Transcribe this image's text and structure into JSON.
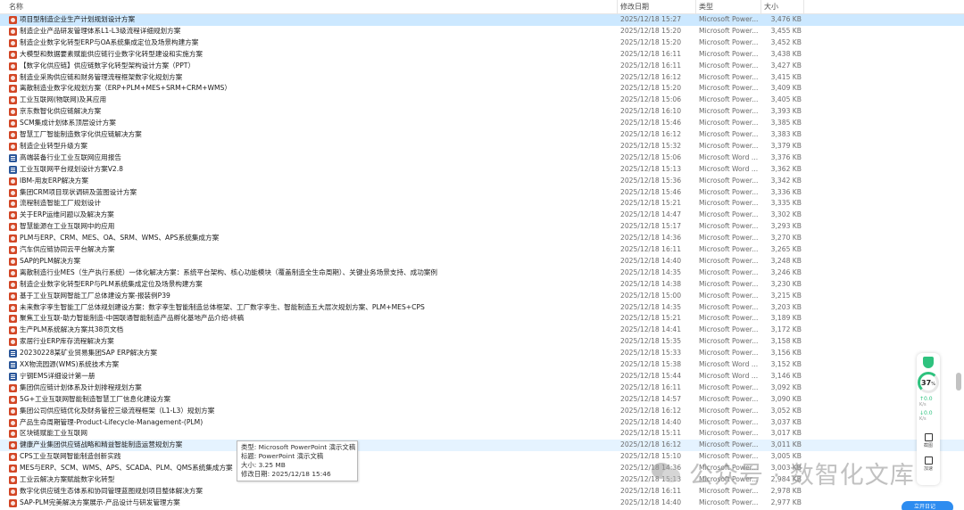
{
  "columns": {
    "name": "名称",
    "date": "修改日期",
    "type": "类型",
    "size": "大小"
  },
  "selected_index": 0,
  "hover_index": 37,
  "files": [
    {
      "name": "项目型制造企业生产计划规划设计方案",
      "date": "2025/12/18 15:27",
      "type": "Microsoft Power...",
      "size": "3,476 KB",
      "icon": "ppt"
    },
    {
      "name": "制造企业产品研发管理体系L1-L3级流程详细规划方案",
      "date": "2025/12/18 15:20",
      "type": "Microsoft Power...",
      "size": "3,455 KB",
      "icon": "ppt"
    },
    {
      "name": "制造企业数字化转型ERP与OA系统集成定位及场景构建方案",
      "date": "2025/12/18 15:20",
      "type": "Microsoft Power...",
      "size": "3,452 KB",
      "icon": "ppt"
    },
    {
      "name": "大模型和数据要素赋能供应链行业数字化转型建设和实施方案",
      "date": "2025/12/18 16:11",
      "type": "Microsoft Power...",
      "size": "3,438 KB",
      "icon": "ppt"
    },
    {
      "name": "【数字化供应链】供应链数字化转型架构设计方案（PPT）",
      "date": "2025/12/18 16:11",
      "type": "Microsoft Power...",
      "size": "3,427 KB",
      "icon": "ppt"
    },
    {
      "name": "制造业采购供应链和财务管理流程框架数字化规划方案",
      "date": "2025/12/18 16:12",
      "type": "Microsoft Power...",
      "size": "3,415 KB",
      "icon": "ppt"
    },
    {
      "name": "离散制造业数字化规划方案（ERP+PLM+MES+SRM+CRM+WMS）",
      "date": "2025/12/18 15:20",
      "type": "Microsoft Power...",
      "size": "3,409 KB",
      "icon": "ppt"
    },
    {
      "name": "工业互联网(物联网)及其应用",
      "date": "2025/12/18 15:06",
      "type": "Microsoft Power...",
      "size": "3,405 KB",
      "icon": "ppt"
    },
    {
      "name": "京东数智化供应链解决方案",
      "date": "2025/12/18 16:10",
      "type": "Microsoft Power...",
      "size": "3,393 KB",
      "icon": "ppt"
    },
    {
      "name": "SCM集成计划体系顶层设计方案",
      "date": "2025/12/18 15:46",
      "type": "Microsoft Power...",
      "size": "3,385 KB",
      "icon": "ppt"
    },
    {
      "name": "智慧工厂智能制造数字化供应链解决方案",
      "date": "2025/12/18 16:12",
      "type": "Microsoft Power...",
      "size": "3,383 KB",
      "icon": "ppt"
    },
    {
      "name": "制造企业转型升级方案",
      "date": "2025/12/18 15:32",
      "type": "Microsoft Power...",
      "size": "3,379 KB",
      "icon": "ppt"
    },
    {
      "name": "高端装备行业工业互联网应用报告",
      "date": "2025/12/18 15:06",
      "type": "Microsoft Word ...",
      "size": "3,376 KB",
      "icon": "doc"
    },
    {
      "name": "工业互联网平台规划设计方案V2.8",
      "date": "2025/12/18 15:13",
      "type": "Microsoft Word ...",
      "size": "3,362 KB",
      "icon": "doc"
    },
    {
      "name": "IBM-用友ERP解决方案",
      "date": "2025/12/18 15:36",
      "type": "Microsoft Power...",
      "size": "3,342 KB",
      "icon": "ppt"
    },
    {
      "name": "集团CRM项目现状调研及蓝图设计方案",
      "date": "2025/12/18 15:46",
      "type": "Microsoft Power...",
      "size": "3,336 KB",
      "icon": "ppt"
    },
    {
      "name": "流程制造智能工厂规划设计",
      "date": "2025/12/18 15:21",
      "type": "Microsoft Power...",
      "size": "3,335 KB",
      "icon": "ppt"
    },
    {
      "name": "关于ERP运维问题以及解决方案",
      "date": "2025/12/18 14:47",
      "type": "Microsoft Power...",
      "size": "3,302 KB",
      "icon": "ppt"
    },
    {
      "name": "智慧能源在工业互联网中的应用",
      "date": "2025/12/18 15:17",
      "type": "Microsoft Power...",
      "size": "3,293 KB",
      "icon": "ppt"
    },
    {
      "name": "PLM与ERP、CRM、MES、OA、SRM、WMS、APS系统集成方案",
      "date": "2025/12/18 14:36",
      "type": "Microsoft Power...",
      "size": "3,270 KB",
      "icon": "ppt"
    },
    {
      "name": "汽车供应链协同云平台解决方案",
      "date": "2025/12/18 16:11",
      "type": "Microsoft Power...",
      "size": "3,265 KB",
      "icon": "ppt"
    },
    {
      "name": "SAP的PLM解决方案",
      "date": "2025/12/18 14:40",
      "type": "Microsoft Power...",
      "size": "3,248 KB",
      "icon": "ppt"
    },
    {
      "name": "离散制造行业MES（生产执行系统）一体化解决方案：系统平台架构、核心功能模块（覆盖制造全生命周期）、关键业务场景支持、成功案例",
      "date": "2025/12/18 14:35",
      "type": "Microsoft Power...",
      "size": "3,246 KB",
      "icon": "ppt"
    },
    {
      "name": "制造企业数字化转型ERP与PLM系统集成定位及场景构建方案",
      "date": "2025/12/18 14:38",
      "type": "Microsoft Power...",
      "size": "3,230 KB",
      "icon": "ppt"
    },
    {
      "name": "基于工业互联网智能工厂总体建设方案-报装例P39",
      "date": "2025/12/18 15:00",
      "type": "Microsoft Power...",
      "size": "3,215 KB",
      "icon": "ppt"
    },
    {
      "name": "未来数字孪生智能工厂总体规划建设方案：数字孪生智能制造总体框架、工厂数字孪生、智能制造五大层次规划方案、PLM+MES+CPS",
      "date": "2025/12/18 14:35",
      "type": "Microsoft Power...",
      "size": "3,203 KB",
      "icon": "ppt"
    },
    {
      "name": "聚焦工业互联-助力智能制造-中国联通智能制造产品孵化基地产品介绍-终稿",
      "date": "2025/12/18 15:21",
      "type": "Microsoft Power...",
      "size": "3,189 KB",
      "icon": "ppt"
    },
    {
      "name": "生产PLM系统解决方案共38页文档",
      "date": "2025/12/18 14:41",
      "type": "Microsoft Power...",
      "size": "3,172 KB",
      "icon": "ppt"
    },
    {
      "name": "家居行业ERP库存流程解决方案",
      "date": "2025/12/18 15:35",
      "type": "Microsoft Power...",
      "size": "3,158 KB",
      "icon": "ppt"
    },
    {
      "name": "20230228某矿业贸易集团SAP ERP解决方案",
      "date": "2025/12/18 15:33",
      "type": "Microsoft Power...",
      "size": "3,156 KB",
      "icon": "doc"
    },
    {
      "name": "XX物流园源(WMS)系统技术方案",
      "date": "2025/12/18 15:38",
      "type": "Microsoft Word ...",
      "size": "3,152 KB",
      "icon": "doc"
    },
    {
      "name": "宁钢EMS详细设计第一册",
      "date": "2025/12/18 15:44",
      "type": "Microsoft Word ...",
      "size": "3,146 KB",
      "icon": "doc"
    },
    {
      "name": "集团供应链计划体系及计划排程规划方案",
      "date": "2025/12/18 16:11",
      "type": "Microsoft Power...",
      "size": "3,092 KB",
      "icon": "ppt"
    },
    {
      "name": "5G+工业互联网智能制造智慧工厂信息化建设方案",
      "date": "2025/12/18 14:57",
      "type": "Microsoft Power...",
      "size": "3,090 KB",
      "icon": "ppt"
    },
    {
      "name": "集团公司供应链优化及财务管控三级流程框架（L1-L3）规划方案",
      "date": "2025/12/18 16:12",
      "type": "Microsoft Power...",
      "size": "3,052 KB",
      "icon": "ppt"
    },
    {
      "name": "产品生命周期管理-Product-Lifecycle-Management-(PLM)",
      "date": "2025/12/18 14:40",
      "type": "Microsoft Power...",
      "size": "3,037 KB",
      "icon": "ppt"
    },
    {
      "name": "区块链赋能工业互联网",
      "date": "2025/12/18 15:11",
      "type": "Microsoft Power...",
      "size": "3,017 KB",
      "icon": "ppt"
    },
    {
      "name": "健康产业集团供应链战略和精益智能制造运营规划方案",
      "date": "2025/12/18 16:12",
      "type": "Microsoft Power...",
      "size": "3,011 KB",
      "icon": "ppt"
    },
    {
      "name": "CPS工业互联网智能制造创新实践",
      "date": "2025/12/18 15:10",
      "type": "Microsoft Power...",
      "size": "3,005 KB",
      "icon": "ppt"
    },
    {
      "name": "MES与ERP、SCM、WMS、APS、SCADA、PLM、QMS系统集成方案",
      "date": "2025/12/18 14:36",
      "type": "Microsoft Power...",
      "size": "3,003 KB",
      "icon": "ppt"
    },
    {
      "name": "工业云解决方案赋能数字化转型",
      "date": "2025/12/18 15:13",
      "type": "Microsoft Power...",
      "size": "2,984 KB",
      "icon": "ppt"
    },
    {
      "name": "数字化供应链生态体系和协同管理蓝图规划项目整体解决方案",
      "date": "2025/12/18 16:11",
      "type": "Microsoft Power...",
      "size": "2,978 KB",
      "icon": "ppt"
    },
    {
      "name": "SAP-PLM完美解决方案展示-产品设计与研发管理方案",
      "date": "2025/12/18 14:40",
      "type": "Microsoft Power...",
      "size": "2,977 KB",
      "icon": "ppt"
    }
  ],
  "tooltip": {
    "type": "类型: Microsoft PowerPoint 演示文稿",
    "title": "标题: PowerPoint 演示文稿",
    "size": "大小: 3.25 MB",
    "modified": "修改日期: 2025/12/18 15:46"
  },
  "watermark": {
    "text": "公众号 · 数智化文库",
    "icon": "wechat-icon"
  },
  "side_widget": {
    "percent": "37",
    "percent_unit": "%",
    "upload_value": "0.0",
    "upload_unit": "K/s",
    "download_value": "0.0",
    "download_unit": "K/s",
    "btn1_label": "截图",
    "btn2_label": "加速"
  },
  "bottom_pill_label": "立开日记"
}
